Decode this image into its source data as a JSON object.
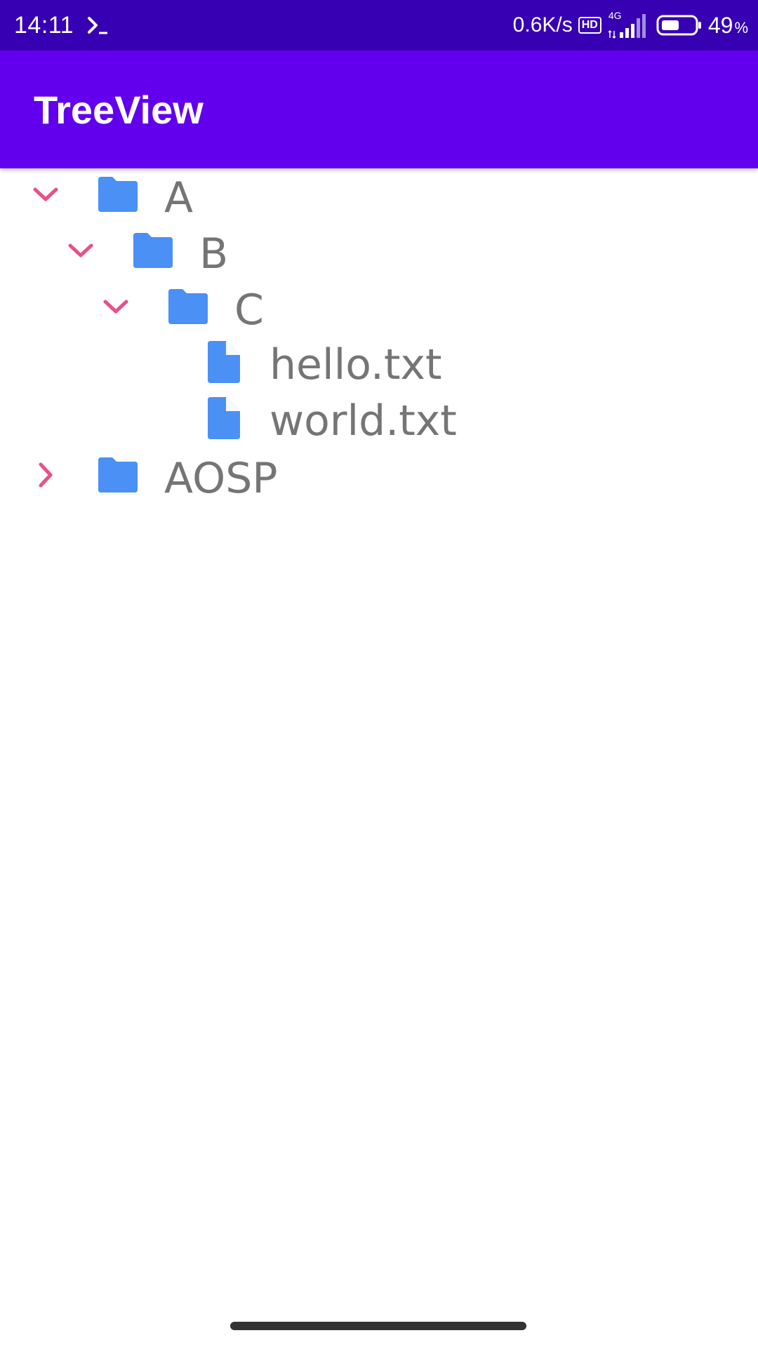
{
  "status_bar": {
    "time": "14:11",
    "terminal_glyph": "❯_",
    "net_speed": "0.6K/s",
    "hd_badge": "HD",
    "network_type": "4G",
    "battery_percent": "49",
    "battery_percent_sign": "%",
    "battery_level": 0.49,
    "icons": [
      "terminal-icon",
      "hd-icon",
      "signal-icon",
      "battery-icon"
    ]
  },
  "app_bar": {
    "title": "TreeView",
    "color": "#6200ee"
  },
  "colors": {
    "status_bar": "#3700b3",
    "arrow": "#e8508a",
    "folder": "#4a90f5",
    "file": "#4a90f5",
    "label": "#757575"
  },
  "tree": {
    "nodes": [
      {
        "label": "A",
        "type": "folder",
        "depth": 0,
        "expanded": true,
        "icon": "folder-icon",
        "arrow": "chevron-down-icon"
      },
      {
        "label": "B",
        "type": "folder",
        "depth": 1,
        "expanded": true,
        "icon": "folder-icon",
        "arrow": "chevron-down-icon"
      },
      {
        "label": "C",
        "type": "folder",
        "depth": 2,
        "expanded": true,
        "icon": "folder-icon",
        "arrow": "chevron-down-icon"
      },
      {
        "label": "hello.txt",
        "type": "file",
        "depth": 3,
        "icon": "file-icon"
      },
      {
        "label": "world.txt",
        "type": "file",
        "depth": 3,
        "icon": "file-icon"
      },
      {
        "label": "AOSP",
        "type": "folder",
        "depth": 0,
        "expanded": false,
        "icon": "folder-icon",
        "arrow": "chevron-right-icon"
      }
    ]
  }
}
